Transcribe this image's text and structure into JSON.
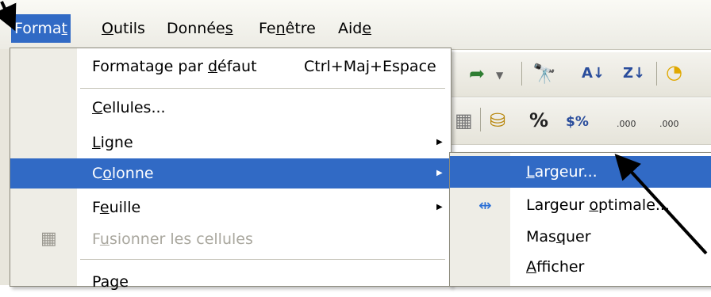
{
  "menubar": {
    "items": [
      {
        "label": "Format",
        "mnemonic": "t",
        "active": true
      },
      {
        "label": "Outils",
        "mnemonic": "O"
      },
      {
        "label": "Données",
        "mnemonic": "s"
      },
      {
        "label": "Fenêtre",
        "mnemonic": "n"
      },
      {
        "label": "Aide",
        "mnemonic": "e"
      }
    ]
  },
  "format_menu": {
    "items": [
      {
        "label": "Formatage par défaut",
        "shortcut": "Ctrl+Maj+Espace"
      },
      {
        "label": "Cellules..."
      },
      {
        "label": "Ligne",
        "submenu": true
      },
      {
        "label": "Colonne",
        "submenu": true,
        "highlighted": true
      },
      {
        "label": "Feuille",
        "submenu": true
      },
      {
        "label": "Fusionner les cellules",
        "disabled": true
      },
      {
        "label": "Page"
      }
    ]
  },
  "colonne_submenu": {
    "items": [
      {
        "label": "Largeur...",
        "highlighted": true
      },
      {
        "label": "Largeur optimale..."
      },
      {
        "label": "Masquer"
      },
      {
        "label": "Afficher"
      }
    ]
  },
  "toolbar": {
    "percent_label": "%",
    "currency_label": "$%",
    "sort_asc_label": "A↓",
    "sort_desc_label": "Z↓",
    "dec_add_label": ".000",
    "dec_del_label": ".000"
  },
  "colors": {
    "highlight": "#316ac5",
    "menu_gutter": "#eeede6",
    "disabled_text": "#a9a79e"
  }
}
